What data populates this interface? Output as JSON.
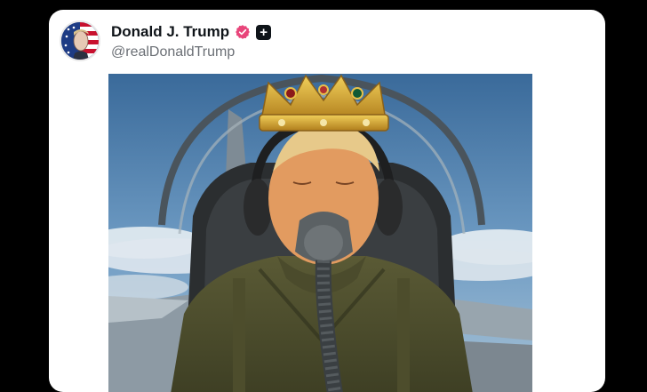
{
  "post": {
    "author_name": "Donald J. Trump",
    "author_handle": "@realDonaldTrump",
    "verified_badge_icon": "verified-badge-icon",
    "extra_badge_icon": "plus-badge-icon",
    "media_description_icon": "post-image"
  },
  "colors": {
    "background": "#000000",
    "card": "#ffffff",
    "name_text": "#0f1419",
    "handle_text": "#6b6f75",
    "verified_badge": "#e8457a"
  }
}
